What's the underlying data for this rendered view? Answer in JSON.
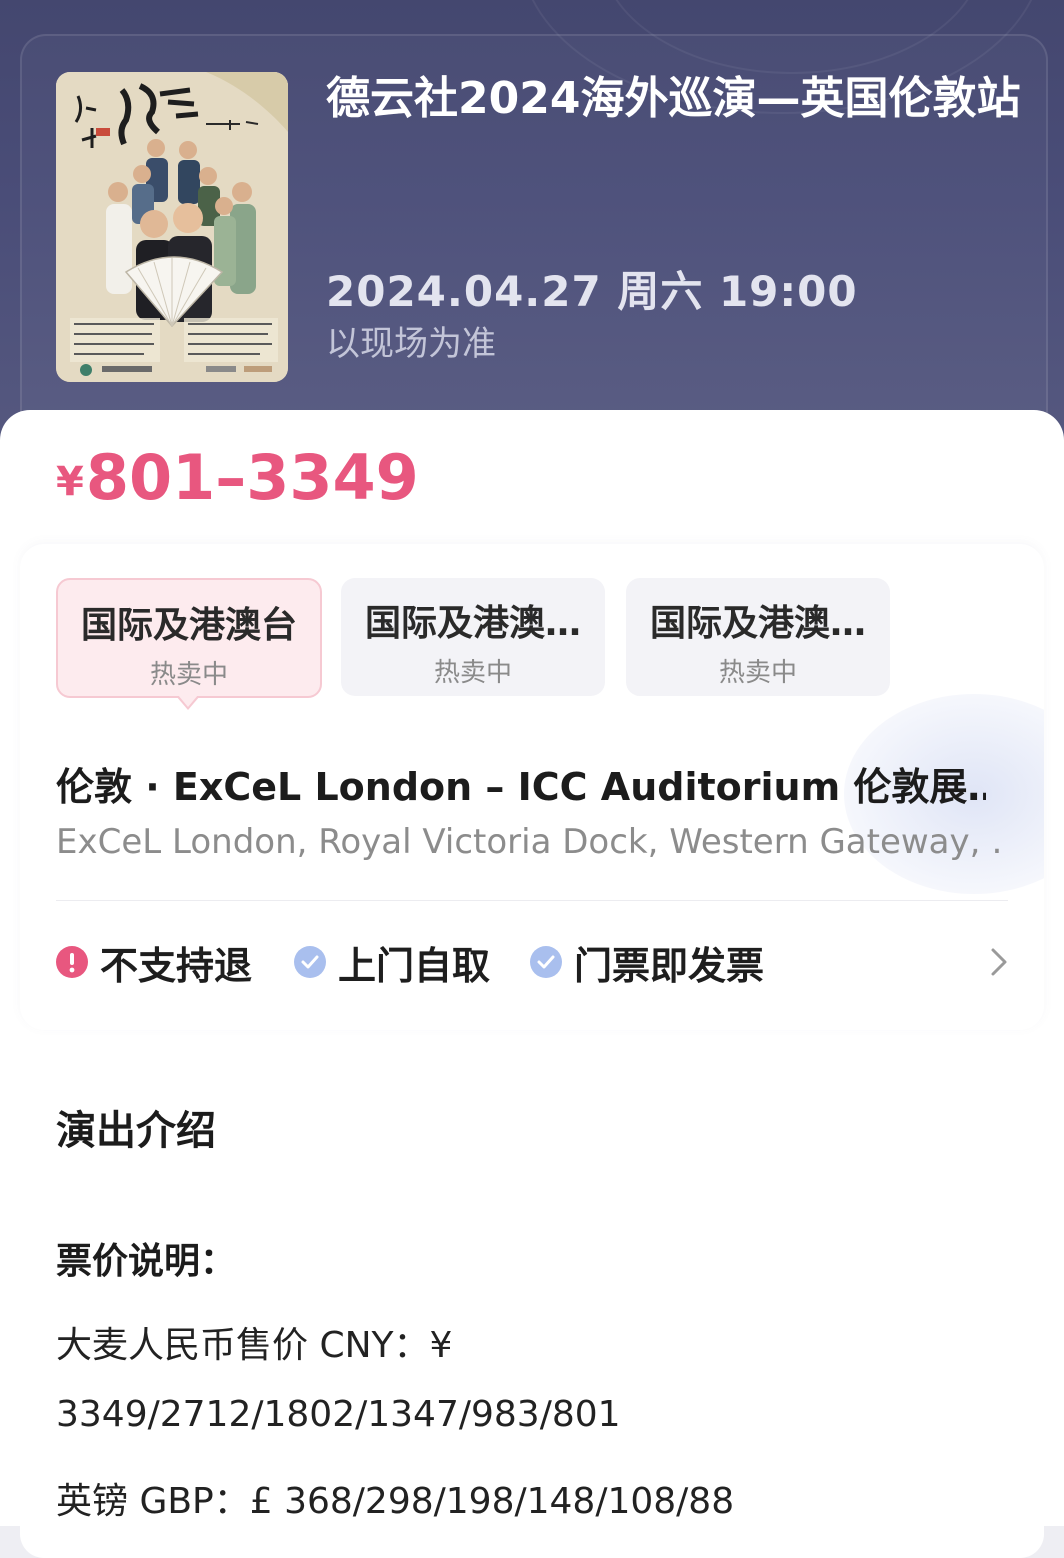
{
  "event": {
    "title": "德云社2024海外巡演—英国伦敦站",
    "datetime": "2024.04.27 周六 19:00",
    "datetime_note": "以现场为准",
    "poster_icon": "event-poster-image"
  },
  "price": {
    "currency": "¥",
    "range": "801–3349",
    "color": "#e8577f"
  },
  "sessions": [
    {
      "title": "国际及港澳台",
      "status": "热卖中",
      "selected": true
    },
    {
      "title": "国际及港澳…",
      "status": "热卖中",
      "selected": false
    },
    {
      "title": "国际及港澳…",
      "status": "热卖中",
      "selected": false
    }
  ],
  "venue": {
    "name": "伦敦 · ExCeL London – ICC Auditorium 伦敦展…",
    "address": "ExCeL London, Royal Victoria Dock, Western Gateway, …"
  },
  "services": [
    {
      "label": "不支持退",
      "icon": "exclamation-icon",
      "color": "#e8577f"
    },
    {
      "label": "上门自取",
      "icon": "check-icon",
      "color": "#9fb6ea"
    },
    {
      "label": "门票即发票",
      "icon": "check-icon",
      "color": "#9fb6ea"
    }
  ],
  "intro": {
    "heading": "演出介绍",
    "price_heading": "票价说明：",
    "lines": [
      "大麦人民币售价 CNY：¥",
      "3349/2712/1802/1347/983/801",
      "英镑 GBP：£ 368/298/198/148/108/88"
    ]
  }
}
